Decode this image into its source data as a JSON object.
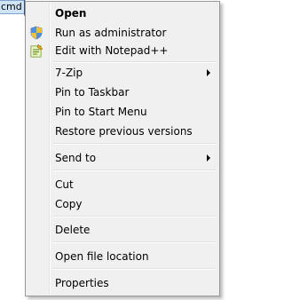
{
  "taskbar_item": {
    "label": "cmd"
  },
  "menu": {
    "items": [
      {
        "label": "Open",
        "icon": "",
        "bold": true,
        "submenu": false
      },
      {
        "label": "Run as administrator",
        "icon": "uac-shield-icon",
        "bold": false,
        "submenu": false
      },
      {
        "label": "Edit with Notepad++",
        "icon": "notepad-plus-plus-icon",
        "bold": false,
        "submenu": false
      },
      {
        "label": "7-Zip",
        "icon": "",
        "bold": false,
        "submenu": true
      },
      {
        "label": "Pin to Taskbar",
        "icon": "",
        "bold": false,
        "submenu": false
      },
      {
        "label": "Pin to Start Menu",
        "icon": "",
        "bold": false,
        "submenu": false
      },
      {
        "label": "Restore previous versions",
        "icon": "",
        "bold": false,
        "submenu": false
      },
      {
        "label": "Send to",
        "icon": "",
        "bold": false,
        "submenu": true
      },
      {
        "label": "Cut",
        "icon": "",
        "bold": false,
        "submenu": false
      },
      {
        "label": "Copy",
        "icon": "",
        "bold": false,
        "submenu": false
      },
      {
        "label": "Delete",
        "icon": "",
        "bold": false,
        "submenu": false
      },
      {
        "label": "Open file location",
        "icon": "",
        "bold": false,
        "submenu": false
      },
      {
        "label": "Properties",
        "icon": "",
        "bold": false,
        "submenu": false
      }
    ]
  },
  "colors": {
    "menu_background": "#f0f0f0",
    "menu_border": "#979797",
    "label_highlight": "#cfe3f7"
  }
}
